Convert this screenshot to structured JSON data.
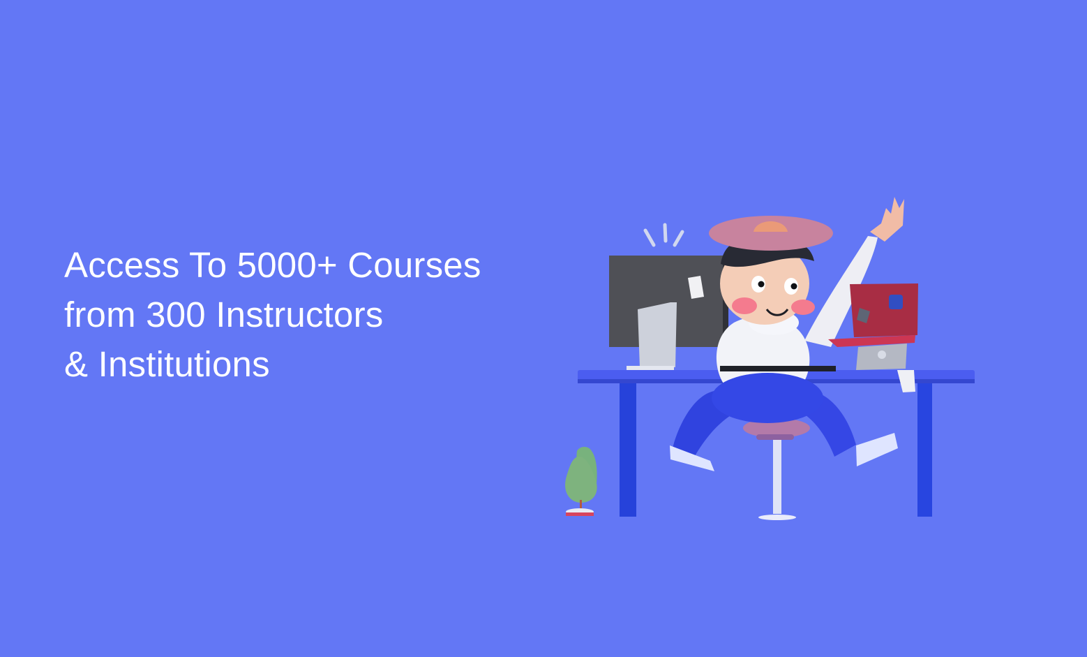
{
  "hero": {
    "headline_lines": [
      "Access To 5000+ Courses",
      "from 300 Instructors",
      "& Institutions"
    ]
  },
  "colors": {
    "background": "#6377f5",
    "text": "#ffffff",
    "desk": "#3b4de3",
    "monitor": "#4e4f56",
    "laptop": "#b72f45",
    "plant": "#78b27d"
  },
  "illustration": {
    "subject": "student-at-desk-illustration"
  }
}
